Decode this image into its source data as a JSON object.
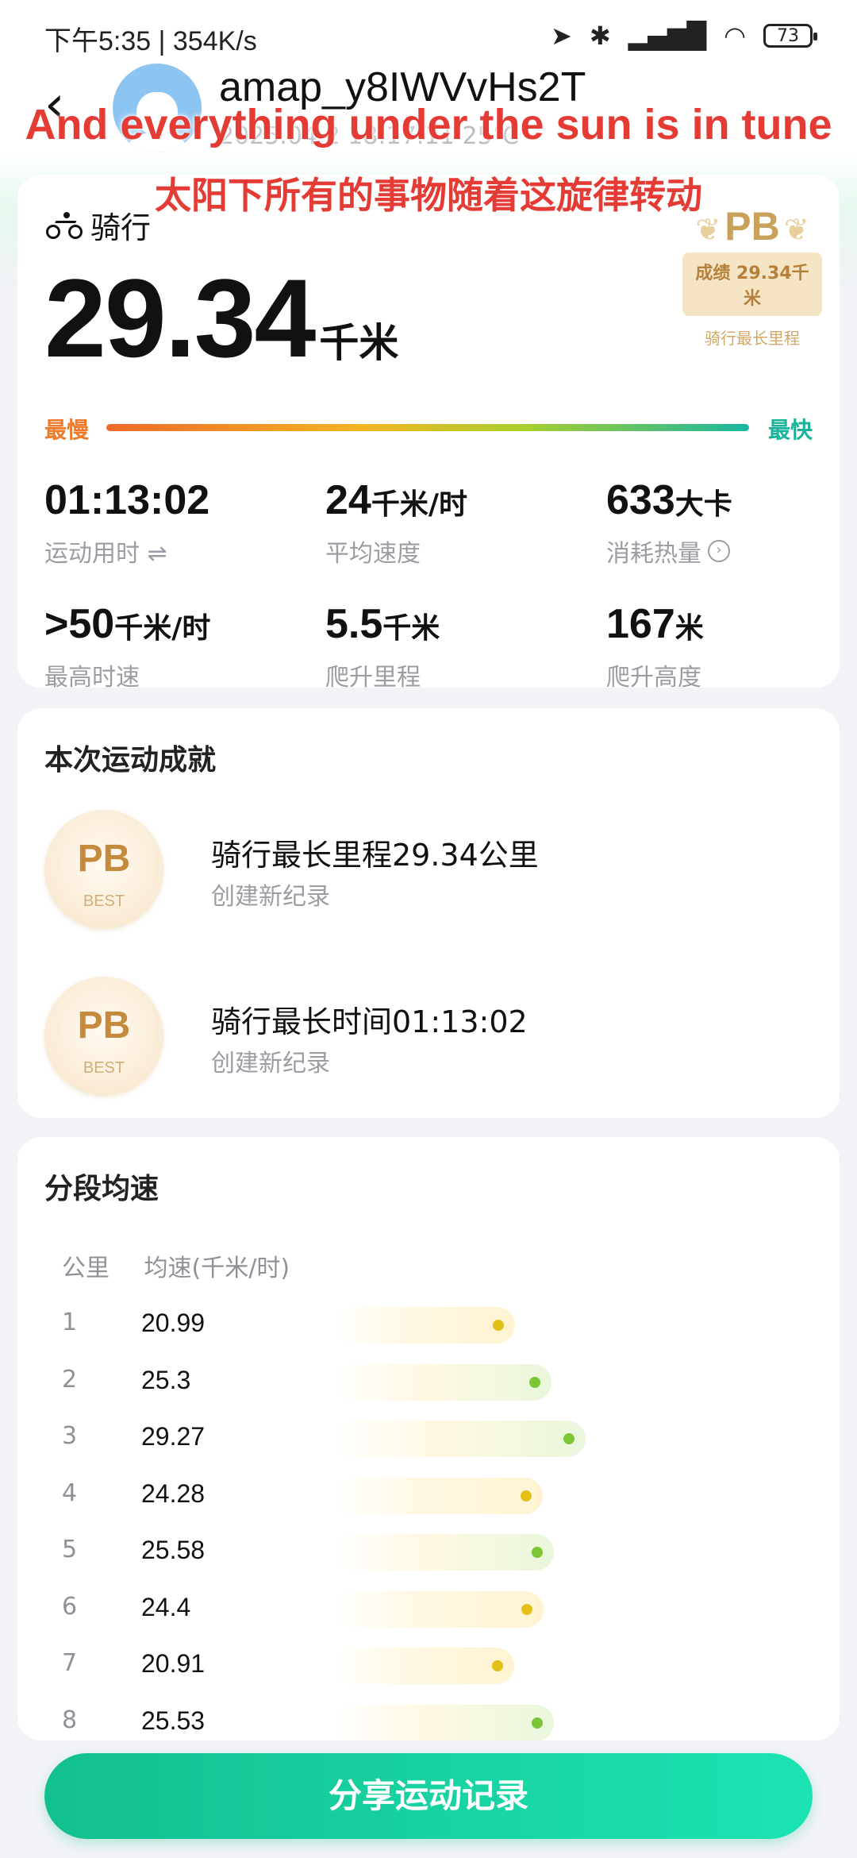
{
  "status_bar": {
    "time": "下午5:35 | 354K/s",
    "battery": "73"
  },
  "header": {
    "username": "amap_y8IWVvHs2T",
    "date": "2025.04.2 18:17:11 25℃"
  },
  "overlay": {
    "line1": "And everything under the sun is in tune",
    "line2": "太阳下所有的事物随着这旋律转动"
  },
  "summary": {
    "sport_type": "骑行",
    "distance_value": "29.34",
    "distance_unit": "千米",
    "pb": {
      "label": "PB",
      "result": "成绩 29.34千米",
      "note": "骑行最长里程"
    },
    "speed_scale": {
      "slow": "最慢",
      "fast": "最快"
    },
    "stats": [
      {
        "value": "01:13:02",
        "unit": "",
        "label": "运动用时 ⇌"
      },
      {
        "value": "24",
        "unit": "千米/时",
        "label": "平均速度"
      },
      {
        "value": "633",
        "unit": "大卡",
        "label": "消耗热量"
      },
      {
        "value": ">50",
        "unit": "千米/时",
        "label": "最高时速"
      },
      {
        "value": "5.5",
        "unit": "千米",
        "label": "爬升里程"
      },
      {
        "value": "167",
        "unit": "米",
        "label": "爬升高度"
      }
    ]
  },
  "achievements": {
    "title": "本次运动成就",
    "items": [
      {
        "badge": "PB",
        "badge_sub": "BEST",
        "title": "骑行最长里程29.34公里",
        "subtitle": "创建新纪录"
      },
      {
        "badge": "PB",
        "badge_sub": "BEST",
        "title": "骑行最长时间01:13:02",
        "subtitle": "创建新纪录"
      }
    ]
  },
  "splits": {
    "title": "分段均速",
    "col_km": "公里",
    "col_speed": "均速(千米/时)",
    "rows": [
      {
        "km": "1",
        "speed": "20.99",
        "value": 20.99
      },
      {
        "km": "2",
        "speed": "25.3",
        "value": 25.3
      },
      {
        "km": "3",
        "speed": "29.27",
        "value": 29.27
      },
      {
        "km": "4",
        "speed": "24.28",
        "value": 24.28
      },
      {
        "km": "5",
        "speed": "25.58",
        "value": 25.58
      },
      {
        "km": "6",
        "speed": "24.4",
        "value": 24.4
      },
      {
        "km": "7",
        "speed": "20.91",
        "value": 20.91
      },
      {
        "km": "8",
        "speed": "25.53",
        "value": 25.53
      }
    ]
  },
  "share_button": "分享运动记录"
}
